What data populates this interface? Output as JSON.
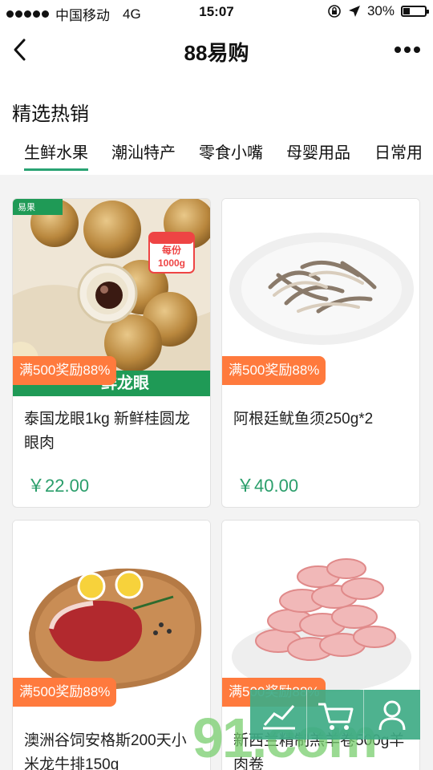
{
  "status_bar": {
    "carrier": "中国移动",
    "network": "4G",
    "time": "15:07",
    "battery": "30%",
    "battery_level": 0.3
  },
  "nav": {
    "title": "88易购"
  },
  "section": {
    "title": "精选热销",
    "tabs": [
      "生鲜水果",
      "潮汕特产",
      "零食小嘴",
      "母婴用品",
      "日常用"
    ],
    "active_tab": 0
  },
  "products": [
    {
      "name": "泰国龙眼1kg 新鲜桂圆龙眼肉",
      "price": "￥22.00",
      "promo": "满500奖励88%",
      "image_badge": "每份\n1000g",
      "image_badge_line1": "每份",
      "image_badge_line2": "1000g",
      "image_brand": "易果",
      "image_banner": "鲜龙眼"
    },
    {
      "name": "阿根廷鱿鱼须250g*2",
      "price": "￥40.00",
      "promo": "满500奖励88%"
    },
    {
      "name": "澳洲谷饲安格斯200天小米龙牛排150g",
      "price": "",
      "promo": "满500奖励88%"
    },
    {
      "name": "新西兰精制羔羊卷500g羊肉卷",
      "price": "",
      "promo": "满500奖励88%"
    }
  ],
  "watermark": "91.com",
  "colors": {
    "accent": "#29a373",
    "price": "#2a9e6b",
    "promo": "#ff7a3d",
    "fab": "#3fab86"
  }
}
